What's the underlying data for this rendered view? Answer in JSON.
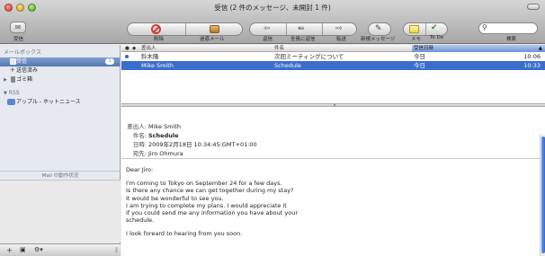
{
  "window": {
    "title": "受信 (2 件のメッセージ、未開封 1 件)"
  },
  "toolbar": {
    "get_mail": "受信",
    "delete": "削除",
    "junk": "迷惑メール",
    "reply": "返信",
    "reply_all": "全員に返信",
    "forward": "転送",
    "new_message": "新規メッセージ",
    "note": "メモ",
    "todo": "To Do",
    "search": "検索",
    "search_placeholder": ""
  },
  "sidebar": {
    "mailboxes_header": "メールボックス",
    "items": [
      {
        "label": "受信",
        "badge": "1"
      },
      {
        "label": "送信済み"
      },
      {
        "label": "ゴミ箱"
      }
    ],
    "rss_header": "RSS",
    "rss_items": [
      {
        "label": "アップル - ホットニュース"
      }
    ],
    "activity_label": "Mail の動作状況"
  },
  "list": {
    "columns": {
      "status": "●",
      "attach": "◆",
      "from": "差出人",
      "subject": "件名",
      "date": "受信日時"
    },
    "rows": [
      {
        "from": "鈴木隆",
        "subject": "次回ミーティングについて",
        "date": "今日",
        "time": "10:06",
        "unread": true
      },
      {
        "from": "Mike Smith",
        "subject": "Schedule",
        "date": "今日",
        "time": "10:33",
        "unread": false
      }
    ]
  },
  "preview": {
    "from_label": "差出人:",
    "from_value": "Mike Smith",
    "subject_label": "件名:",
    "subject_value": "Schedule",
    "date_label": "日時:",
    "date_value": "2009年2月18日 10:34:45:GMT+01:00",
    "to_label": "宛先:",
    "to_value": "Jiro Ohmura",
    "body_greeting": "Dear Jiro:",
    "body_lines": [
      "I'm coming to Tokyo on September 24 for a few days.",
      "Is there any chance we can get together during my stay?",
      "It would be wonderful to see you.",
      "I am trying to complete my plans. I would appreciate it",
      "if you could send me any information you have about your",
      "schedule."
    ],
    "body_closing": "I look foreard to hearing from you soon."
  },
  "colors": {
    "selection": "#3b6dcc",
    "unread_dot": "#2f6ad0",
    "sidebar_bg": "#e6eaf0"
  }
}
